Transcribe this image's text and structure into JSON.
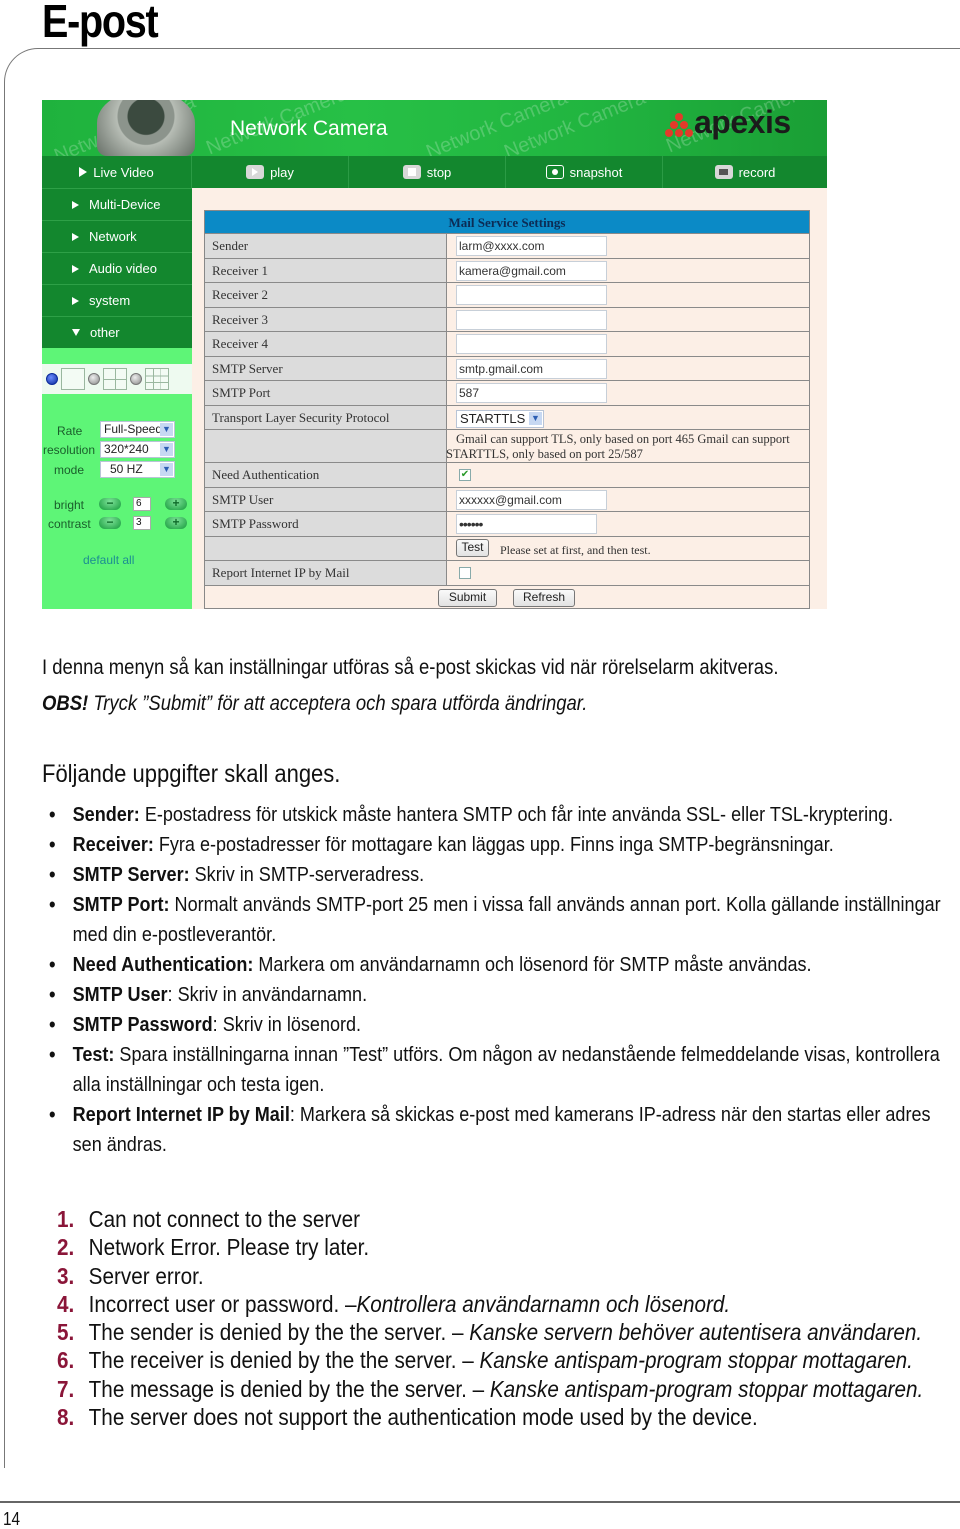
{
  "page": {
    "title": "E-post",
    "page_number": "14"
  },
  "camera_ui": {
    "brand_title": "Network Camera",
    "watermark": "Network Camera",
    "logo": "apexis",
    "toolbar": [
      {
        "label": "Live Video",
        "icon": "play-triangle-icon"
      },
      {
        "label": "play",
        "icon": "play-icon"
      },
      {
        "label": "stop",
        "icon": "stop-icon"
      },
      {
        "label": "snapshot",
        "icon": "camera-icon"
      },
      {
        "label": "record",
        "icon": "video-camera-icon"
      }
    ],
    "sidebar": [
      {
        "label": "Multi-Device",
        "expanded": false
      },
      {
        "label": "Network",
        "expanded": false
      },
      {
        "label": "Audio video",
        "expanded": false
      },
      {
        "label": "system",
        "expanded": false
      },
      {
        "label": "other",
        "expanded": true
      }
    ],
    "layout_options": [
      "single-view",
      "quad-view",
      "nine-view"
    ],
    "layout_selected": "single-view",
    "controls": {
      "rate_label": "Rate",
      "rate_value": "Full-Speed",
      "resolution_label": "resolution",
      "resolution_value": "320*240",
      "mode_label": "mode",
      "mode_value": "50 HZ",
      "bright_label": "bright",
      "bright_value": "6",
      "contrast_label": "contrast",
      "contrast_value": "3",
      "minus": "−",
      "plus": "+",
      "default_all": "default all"
    },
    "mail_settings": {
      "header": "Mail Service Settings",
      "sender_label": "Sender",
      "sender_value": "larm@xxxx.com",
      "receiver1_label": "Receiver 1",
      "receiver1_value": "kamera@gmail.com",
      "receiver2_label": "Receiver 2",
      "receiver2_value": "",
      "receiver3_label": "Receiver 3",
      "receiver3_value": "",
      "receiver4_label": "Receiver 4",
      "receiver4_value": "",
      "smtp_server_label": "SMTP Server",
      "smtp_server_value": "smtp.gmail.com",
      "smtp_port_label": "SMTP Port",
      "smtp_port_value": "587",
      "tls_label": "Transport Layer Security Protocol",
      "tls_value": "STARTTLS",
      "tls_note": "Gmail can support TLS, only based on port 465 Gmail can support STARTTLS, only based on port 25/587",
      "need_auth_label": "Need Authentication",
      "need_auth_checked": true,
      "smtp_user_label": "SMTP User",
      "smtp_user_value": "xxxxxx@gmail.com",
      "smtp_password_label": "SMTP Password",
      "smtp_password_value": "••••••",
      "test_button": "Test",
      "test_note": "Please set at first, and then test.",
      "report_ip_label": "Report Internet IP by Mail",
      "report_ip_checked": false,
      "submit_button": "Submit",
      "refresh_button": "Refresh"
    }
  },
  "intro": {
    "line1": "I denna menyn så kan inställningar utföras så e-post skickas vid när rörelselarm akitveras.",
    "obs_bold": "OBS!",
    "obs_text": " Tryck ”Submit” för att acceptera och spara utförda ändringar."
  },
  "fields_heading": "Följande uppgifter skall anges.",
  "bullets": [
    {
      "term": "Sender:",
      "text": " E-postadress för utskick måste hantera SMTP och får inte använda SSL- eller TSL-kryptering."
    },
    {
      "term": "Receiver:",
      "text": " Fyra e-postadresser för mottagare kan läggas upp. Finns inga SMTP-begränsningar."
    },
    {
      "term": "SMTP Server:",
      "text": " Skriv in SMTP-serveradress."
    },
    {
      "term": "SMTP Port:",
      "text": " Normalt används SMTP-port 25 men i vissa fall används annan port. Kolla gällande inställningar",
      "cont": "med din e-postleverantör."
    },
    {
      "term": "Need Authentication:",
      "text": " Markera om användarnamn och lösenord för SMTP måste användas."
    },
    {
      "term": "SMTP User",
      "text": ": Skriv in användarnamn."
    },
    {
      "term": "SMTP Password",
      "text": ": Skriv in lösenord."
    },
    {
      "term": "Test:",
      "text": " Spara inställningarna innan ”Test” utförs. Om någon av nedanstående felmeddelande visas, kontrollera",
      "cont": "alla inställningar och testa igen."
    },
    {
      "term": "Report Internet IP by Mail",
      "text": ": Markera så skickas e-post med kamerans IP-adress när den startas eller adres",
      "cont": "sen ändras."
    }
  ],
  "errors": [
    {
      "num": "1.",
      "text": "Can not connect to the server",
      "hint": ""
    },
    {
      "num": "2.",
      "text": "Network Error. Please try later.",
      "hint": ""
    },
    {
      "num": "3.",
      "text": "Server error.",
      "hint": ""
    },
    {
      "num": "4.",
      "text": "Incorrect user or password. –",
      "hint": "Kontrollera användarnamn och lösenord."
    },
    {
      "num": "5.",
      "text": "The sender is denied by the the server. – ",
      "hint": "Kanske servern behöver autentisera användaren."
    },
    {
      "num": "6.",
      "text": "The receiver is denied by the the server. – ",
      "hint": "Kanske antispam-program stoppar mottagaren."
    },
    {
      "num": "7.",
      "text": "The message is denied by the the server. – ",
      "hint": "Kanske antispam-program stoppar mottagaren."
    },
    {
      "num": "8.",
      "text": "The server does not support the authentication mode used by the device.",
      "hint": ""
    }
  ]
}
